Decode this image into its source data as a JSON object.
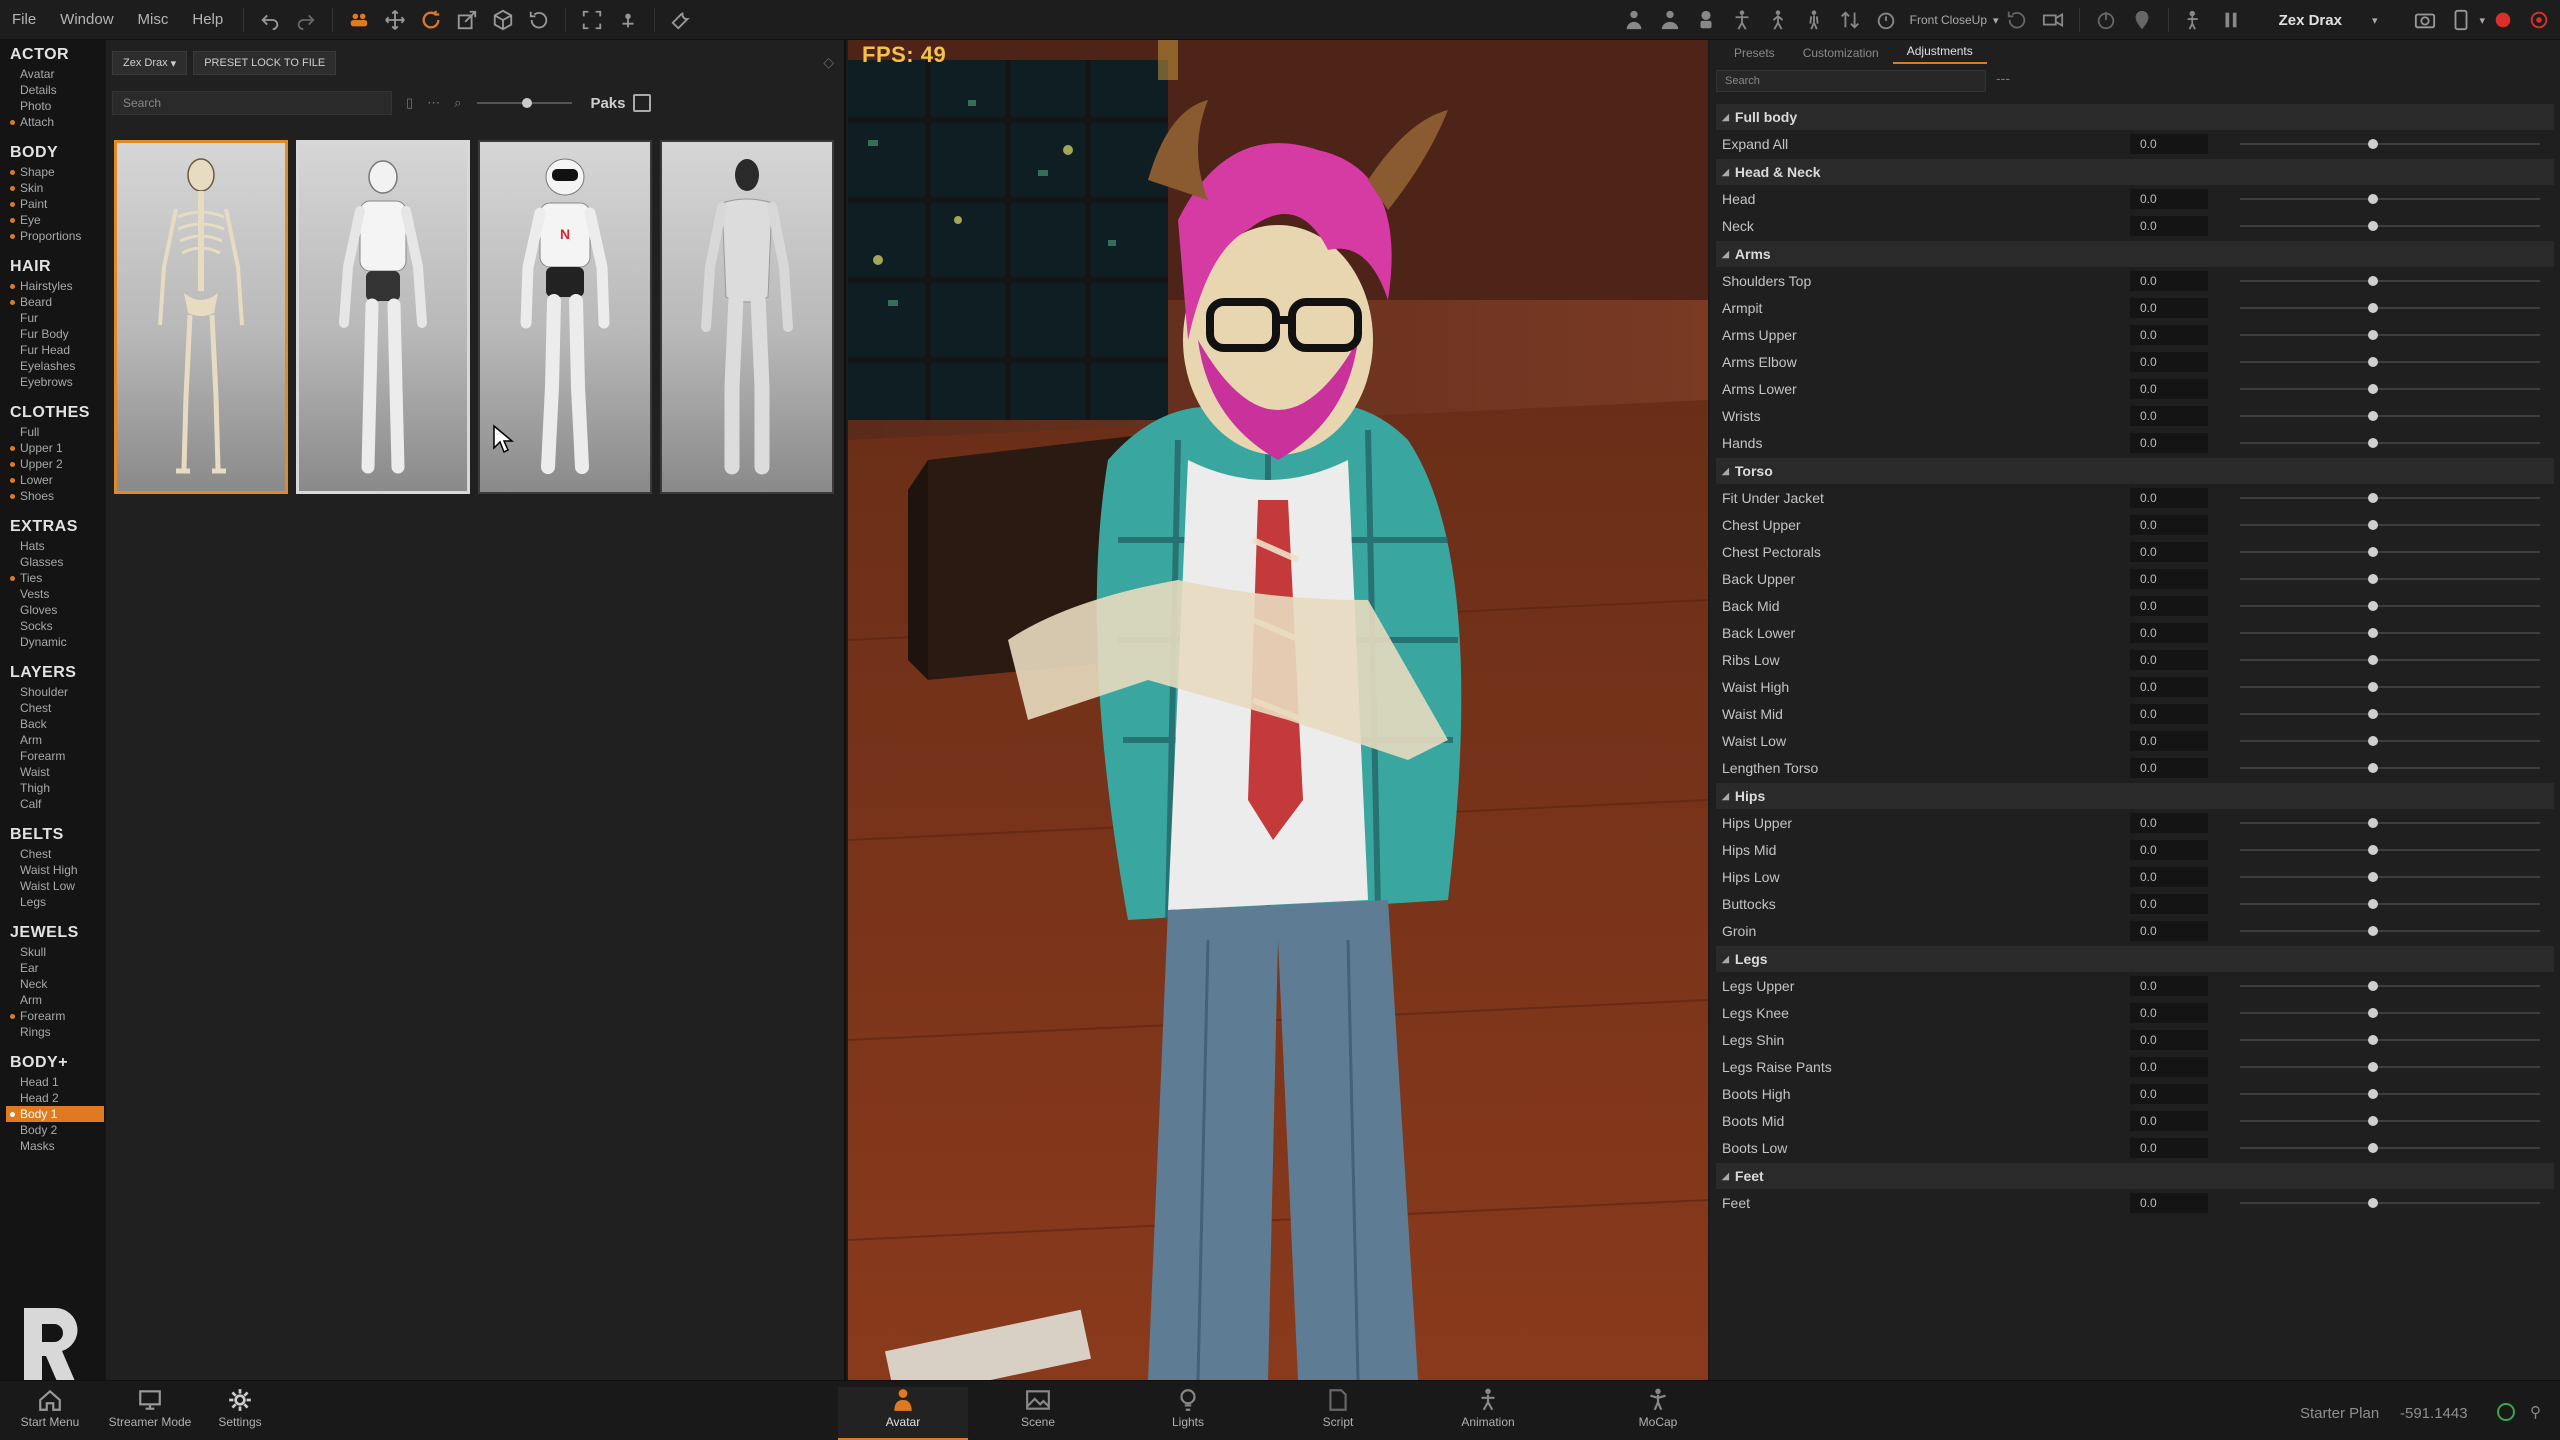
{
  "menu": [
    "File",
    "Window",
    "Misc",
    "Help"
  ],
  "toolbar_right": {
    "camera_label": "Front CloseUp",
    "user_name": "Zex Drax"
  },
  "nav": [
    {
      "head": "ACTOR",
      "items": [
        {
          "label": "Avatar"
        },
        {
          "label": "Details"
        },
        {
          "label": "Photo"
        },
        {
          "label": "Attach",
          "dot": true
        }
      ]
    },
    {
      "head": "BODY",
      "items": [
        {
          "label": "Shape",
          "dot": true
        },
        {
          "label": "Skin",
          "dot": true
        },
        {
          "label": "Paint",
          "dot": true
        },
        {
          "label": "Eye",
          "dot": true
        },
        {
          "label": "Proportions",
          "dot": true
        }
      ]
    },
    {
      "head": "HAIR",
      "items": [
        {
          "label": "Hairstyles",
          "dot": true
        },
        {
          "label": "Beard",
          "dot": true
        },
        {
          "label": "Fur"
        },
        {
          "label": "Fur Body"
        },
        {
          "label": "Fur Head"
        },
        {
          "label": "Eyelashes"
        },
        {
          "label": "Eyebrows"
        }
      ]
    },
    {
      "head": "CLOTHES",
      "items": [
        {
          "label": "Full"
        },
        {
          "label": "Upper 1",
          "dot": true
        },
        {
          "label": "Upper 2",
          "dot": true
        },
        {
          "label": "Lower",
          "dot": true
        },
        {
          "label": "Shoes",
          "dot": true
        }
      ]
    },
    {
      "head": "EXTRAS",
      "items": [
        {
          "label": "Hats"
        },
        {
          "label": "Glasses"
        },
        {
          "label": "Ties",
          "dot": true
        },
        {
          "label": "Vests"
        },
        {
          "label": "Gloves"
        },
        {
          "label": "Socks"
        },
        {
          "label": "Dynamic"
        }
      ]
    },
    {
      "head": "LAYERS",
      "items": [
        {
          "label": "Shoulder"
        },
        {
          "label": "Chest"
        },
        {
          "label": "Back"
        },
        {
          "label": "Arm"
        },
        {
          "label": "Forearm"
        },
        {
          "label": "Waist"
        },
        {
          "label": "Thigh"
        },
        {
          "label": "Calf"
        }
      ]
    },
    {
      "head": "BELTS",
      "items": [
        {
          "label": "Chest"
        },
        {
          "label": "Waist High"
        },
        {
          "label": "Waist Low"
        },
        {
          "label": "Legs"
        }
      ]
    },
    {
      "head": "JEWELS",
      "items": [
        {
          "label": "Skull"
        },
        {
          "label": "Ear"
        },
        {
          "label": "Neck"
        },
        {
          "label": "Arm"
        },
        {
          "label": "Forearm",
          "dot": true
        },
        {
          "label": "Rings"
        }
      ]
    },
    {
      "head": "BODY+",
      "items": [
        {
          "label": "Head 1"
        },
        {
          "label": "Head 2"
        },
        {
          "label": "Body 1",
          "dot": true,
          "active": true
        },
        {
          "label": "Body 2"
        },
        {
          "label": "Masks"
        }
      ]
    }
  ],
  "asset_panel": {
    "actor_chip": "Zex Drax",
    "preset_button": "PRESET LOCK TO FILE",
    "search_placeholder": "Search",
    "paks_label": "Paks",
    "thumbnails": [
      "skeleton",
      "robot-white",
      "robot-helmet",
      "mannequin"
    ]
  },
  "viewport": {
    "fps": "FPS: 49"
  },
  "right_panel": {
    "tabs": [
      {
        "label": "Presets"
      },
      {
        "label": "Customization"
      },
      {
        "label": "Adjustments",
        "active": true
      }
    ],
    "search_placeholder": "Search",
    "more": "---",
    "sections": [
      {
        "title": "Full body",
        "params": [
          {
            "name": "Expand All",
            "value": "0.0"
          }
        ]
      },
      {
        "title": "Head & Neck",
        "params": [
          {
            "name": "Head",
            "value": "0.0"
          },
          {
            "name": "Neck",
            "value": "0.0"
          }
        ]
      },
      {
        "title": "Arms",
        "params": [
          {
            "name": "Shoulders Top",
            "value": "0.0"
          },
          {
            "name": "Armpit",
            "value": "0.0"
          },
          {
            "name": "Arms Upper",
            "value": "0.0"
          },
          {
            "name": "Arms Elbow",
            "value": "0.0"
          },
          {
            "name": "Arms Lower",
            "value": "0.0"
          },
          {
            "name": "Wrists",
            "value": "0.0"
          },
          {
            "name": "Hands",
            "value": "0.0"
          }
        ]
      },
      {
        "title": "Torso",
        "params": [
          {
            "name": "Fit Under Jacket",
            "value": "0.0"
          },
          {
            "name": "Chest Upper",
            "value": "0.0"
          },
          {
            "name": "Chest Pectorals",
            "value": "0.0"
          },
          {
            "name": "Back Upper",
            "value": "0.0"
          },
          {
            "name": "Back Mid",
            "value": "0.0"
          },
          {
            "name": "Back Lower",
            "value": "0.0"
          },
          {
            "name": "Ribs Low",
            "value": "0.0"
          },
          {
            "name": "Waist High",
            "value": "0.0"
          },
          {
            "name": "Waist Mid",
            "value": "0.0"
          },
          {
            "name": "Waist Low",
            "value": "0.0"
          },
          {
            "name": "Lengthen Torso",
            "value": "0.0"
          }
        ]
      },
      {
        "title": "Hips",
        "params": [
          {
            "name": "Hips Upper",
            "value": "0.0"
          },
          {
            "name": "Hips Mid",
            "value": "0.0"
          },
          {
            "name": "Hips Low",
            "value": "0.0"
          },
          {
            "name": "Buttocks",
            "value": "0.0"
          },
          {
            "name": "Groin",
            "value": "0.0"
          }
        ]
      },
      {
        "title": "Legs",
        "params": [
          {
            "name": "Legs Upper",
            "value": "0.0"
          },
          {
            "name": "Legs Knee",
            "value": "0.0"
          },
          {
            "name": "Legs Shin",
            "value": "0.0"
          },
          {
            "name": "Legs Raise Pants",
            "value": "0.0"
          },
          {
            "name": "Boots High",
            "value": "0.0"
          },
          {
            "name": "Boots Mid",
            "value": "0.0"
          },
          {
            "name": "Boots Low",
            "value": "0.0"
          }
        ]
      },
      {
        "title": "Feet",
        "params": [
          {
            "name": "Feet",
            "value": "0.0"
          }
        ]
      }
    ]
  },
  "bottom_bar": {
    "left": [
      {
        "label": "Start Menu",
        "icon": "home-icon"
      },
      {
        "label": "Streamer Mode",
        "icon": "monitor-icon"
      },
      {
        "label": "Settings",
        "icon": "gear-icon"
      }
    ],
    "center": [
      {
        "label": "Avatar",
        "icon": "person-icon",
        "active": true
      },
      {
        "label": "Scene",
        "icon": "landscape-icon"
      },
      {
        "label": "Lights",
        "icon": "bulb-icon"
      },
      {
        "label": "Script",
        "icon": "script-icon"
      },
      {
        "label": "Animation",
        "icon": "animation-icon"
      },
      {
        "label": "MoCap",
        "icon": "mocap-icon"
      }
    ],
    "plan": "Starter Plan",
    "coords": "-591.1443"
  },
  "colors": {
    "accent": "#e07a22",
    "fps": "#f2c24a"
  }
}
